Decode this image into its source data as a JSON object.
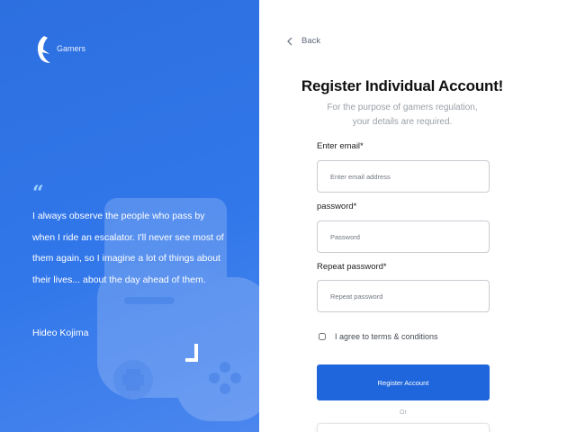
{
  "brand": {
    "name": "Gamers",
    "logo_icon": "stylized-wing-logo-icon"
  },
  "quote": {
    "mark": "“",
    "text": "I always observe the people who pass by when I ride an escalator. I'll never see most of them again, so I imagine a lot of things about their lives... about the day ahead of them.",
    "author": "Hideo Kojima"
  },
  "nav": {
    "back_label": "Back",
    "back_icon": "chevron-left-icon"
  },
  "form": {
    "title": "Register Individual Account!",
    "subtitle": "For the purpose of gamers regulation, your details are required.",
    "email": {
      "label": "Enter email*",
      "placeholder": "Enter email address"
    },
    "password": {
      "label": "password*",
      "placeholder": "Password"
    },
    "repeat_password": {
      "label": "Repeat password*",
      "placeholder": "Repeat password"
    },
    "terms_label": "I agree to terms & conditions",
    "submit_label": "Register Account",
    "or_label": "Or"
  },
  "colors": {
    "left_panel": "#3177ea",
    "primary_button": "#1f66dc",
    "quote_mark": "#9fd4ff"
  }
}
